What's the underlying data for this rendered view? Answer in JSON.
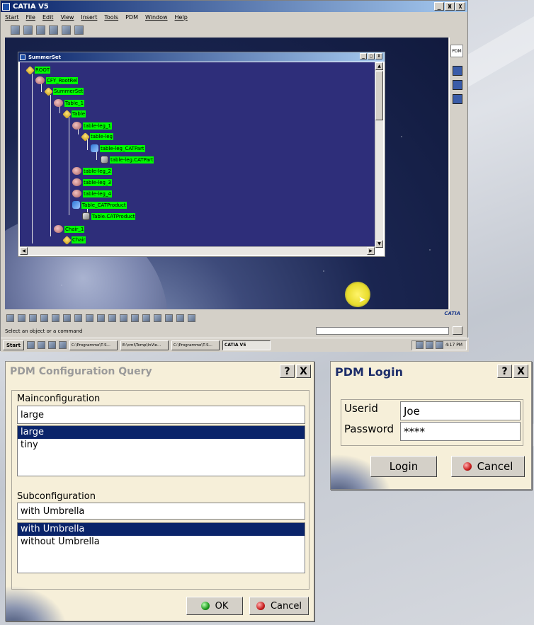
{
  "catia": {
    "title": "CATIA V5",
    "menu": [
      "Start",
      "File",
      "Edit",
      "View",
      "Insert",
      "Tools",
      "PDM",
      "Window",
      "Help"
    ],
    "window_buttons": [
      "_",
      "Ж",
      "X"
    ],
    "side_tab": "PDM",
    "status_text": "Select an object or a command",
    "logo_text": "CATIA",
    "inner_window": {
      "title": "SummerSet",
      "buttons": [
        "_",
        "□",
        "X"
      ]
    },
    "tree": [
      {
        "label": "ROOT",
        "icon": "product-icon"
      },
      {
        "label": "CFY_RootRel",
        "icon": "component-icon"
      },
      {
        "label": "SummerSet",
        "icon": "product-icon"
      },
      {
        "label": "Table_1",
        "icon": "component-icon"
      },
      {
        "label": "Table",
        "icon": "product-icon"
      },
      {
        "label": "table-leg_1",
        "icon": "component-icon"
      },
      {
        "label": "table-leg",
        "icon": "product-icon"
      },
      {
        "label": "table-leg_CATPart",
        "icon": "part-icon"
      },
      {
        "label": "table-leg.CATPart",
        "icon": "file-icon"
      },
      {
        "label": "table-leg_2",
        "icon": "component-icon"
      },
      {
        "label": "table-leg_3",
        "icon": "component-icon"
      },
      {
        "label": "table-leg_4",
        "icon": "component-icon"
      },
      {
        "label": "Table_CATProduct",
        "icon": "part-icon"
      },
      {
        "label": "Table.CATProduct",
        "icon": "file-icon"
      },
      {
        "label": "Chair_1",
        "icon": "component-icon"
      },
      {
        "label": "Chair",
        "icon": "product-icon"
      }
    ],
    "taskbar": {
      "start": "Start",
      "tasks": [
        "C:\\Programme\\T-S...",
        "E:\\cml\\Temp\\InVie...",
        "C:\\Programme\\T-S...",
        "CATIA V5"
      ],
      "clock": "4:17 PM"
    }
  },
  "pdm_query": {
    "title": "PDM Configuration Query",
    "help_button": "?",
    "close_button": "X",
    "main_label": "Mainconfiguration",
    "main_value": "large",
    "main_options": [
      "large",
      "tiny"
    ],
    "main_selected": "large",
    "sub_label": "Subconfiguration",
    "sub_value": "with Umbrella",
    "sub_options": [
      "with Umbrella",
      "without Umbrella"
    ],
    "sub_selected": "with Umbrella",
    "ok_label": "OK",
    "cancel_label": "Cancel"
  },
  "pdm_login": {
    "title": "PDM Login",
    "help_button": "?",
    "close_button": "X",
    "userid_label": "Userid",
    "userid_value": "Joe",
    "password_label": "Password",
    "password_value": "****",
    "login_label": "Login",
    "cancel_label": "Cancel"
  },
  "colors": {
    "dialog_bg": "#f6efd9",
    "selection": "#0a246a",
    "tree_label_bg": "#00ff00",
    "tree_bg": "#2e2e7a"
  }
}
